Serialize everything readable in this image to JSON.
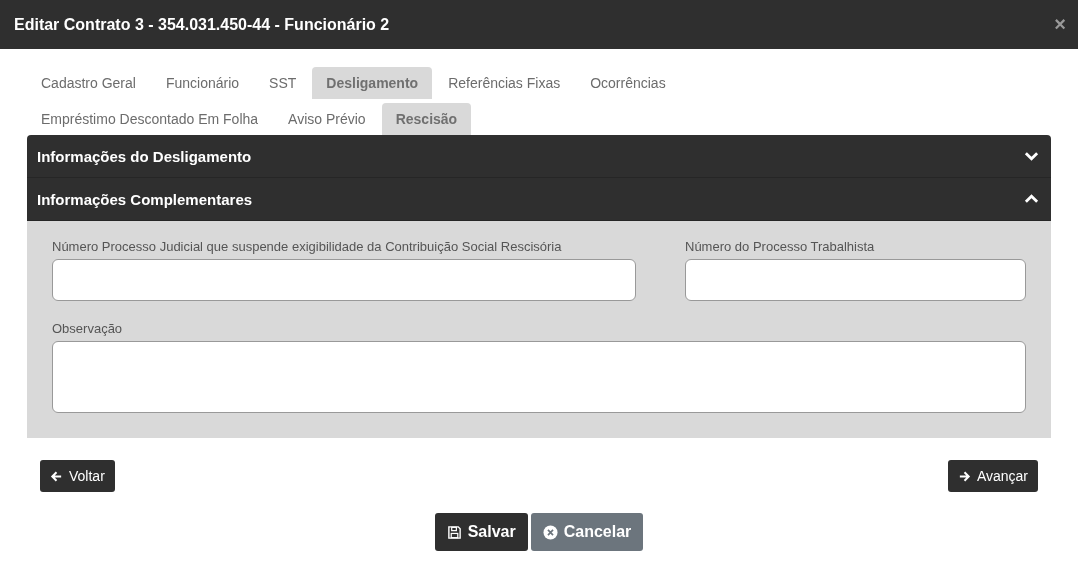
{
  "window": {
    "title": "Editar Contrato 3 - 354.031.450-44 - Funcionário 2",
    "close": "×"
  },
  "tabs": [
    {
      "label": "Cadastro Geral",
      "selected": false
    },
    {
      "label": "Funcionário",
      "selected": false
    },
    {
      "label": "SST",
      "selected": false
    },
    {
      "label": "Desligamento",
      "selected": true
    },
    {
      "label": "Referências Fixas",
      "selected": false
    },
    {
      "label": "Ocorrências",
      "selected": false
    },
    {
      "label": "Empréstimo Descontado Em Folha",
      "selected": false
    },
    {
      "label": "Aviso Prévio",
      "selected": false
    },
    {
      "label": "Rescisão",
      "selected": true
    }
  ],
  "sections": [
    {
      "title": "Informações do Desligamento",
      "expanded": false
    },
    {
      "title": "Informações Complementares",
      "expanded": true,
      "fields": [
        {
          "label": "Número Processo Judicial que suspende exigibilidade da Contribuição Social Rescisória",
          "kind": "input"
        },
        {
          "label": "Número do Processo Trabalhista",
          "kind": "input"
        },
        {
          "label": "Observação",
          "kind": "textarea"
        }
      ]
    }
  ],
  "nav": {
    "back": "Voltar",
    "next": "Avançar"
  },
  "actions": {
    "save": "Salvar",
    "cancel": "Cancelar"
  }
}
